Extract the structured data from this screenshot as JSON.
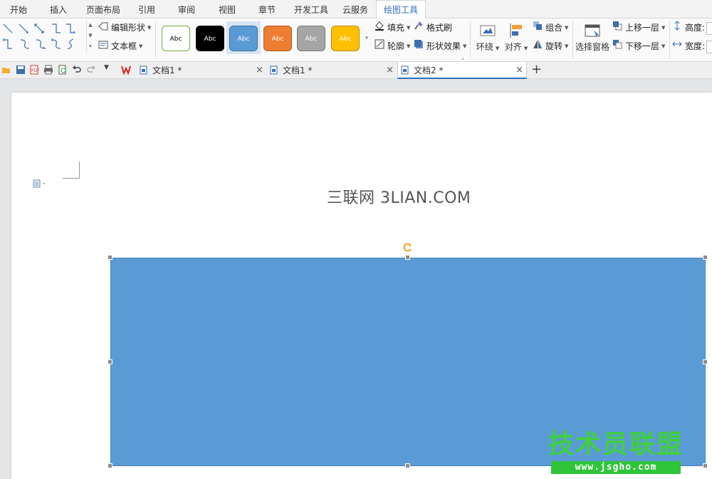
{
  "menu": {
    "tabs": [
      {
        "label": "开始"
      },
      {
        "label": "插入"
      },
      {
        "label": "页面布局"
      },
      {
        "label": "引用"
      },
      {
        "label": "审阅"
      },
      {
        "label": "视图"
      },
      {
        "label": "章节"
      },
      {
        "label": "开发工具"
      },
      {
        "label": "云服务"
      },
      {
        "label": "绘图工具"
      }
    ],
    "active_tab": "绘图工具"
  },
  "ribbon": {
    "edit_shape": "编辑形状",
    "text_box": "文本框",
    "style_presets": [
      {
        "label": "Abc",
        "fill": "#ffffff",
        "border": "#70ad47",
        "text_color": "#000000"
      },
      {
        "label": "Abc",
        "fill": "#000000",
        "border": "#000000",
        "text_color": "#ffffff"
      },
      {
        "label": "Abc",
        "fill": "#5b9bd5",
        "border": "#41719c",
        "text_color": "#ffffff"
      },
      {
        "label": "Abc",
        "fill": "#ed7d31",
        "border": "#ae5a21",
        "text_color": "#ffffff"
      },
      {
        "label": "Abc",
        "fill": "#a5a5a5",
        "border": "#787878",
        "text_color": "#ffffff"
      },
      {
        "label": "Abc",
        "fill": "#ffc000",
        "border": "#bc8c00",
        "text_color": "#ffffff"
      }
    ],
    "fill": "填充",
    "outline": "轮廓",
    "format_painter": "格式刷",
    "shape_effects": "形状效果",
    "wrap": "环绕",
    "align": "对齐",
    "group": "组合",
    "rotate": "旋转",
    "selection_pane": "选择窗格",
    "bring_forward": "上移一层",
    "send_backward": "下移一层",
    "height_label": "高度:",
    "width_label": "宽度:"
  },
  "quickbar": {
    "doc_tabs": [
      {
        "label": "文档1 *"
      },
      {
        "label": "文档1 *"
      },
      {
        "label": "文档2 *"
      }
    ],
    "active_doc": 2
  },
  "document": {
    "watermark_text": "三联网 3LIAN.COM",
    "shape": {
      "fill": "#5b9bd5",
      "selected": true
    }
  },
  "brand": {
    "title": "技术员联盟",
    "url": "www.jsgho.com"
  },
  "colors": {
    "accent": "#2f6fbd",
    "shape_fill": "#5b9bd5",
    "brand_green": "#3fcf3f"
  }
}
